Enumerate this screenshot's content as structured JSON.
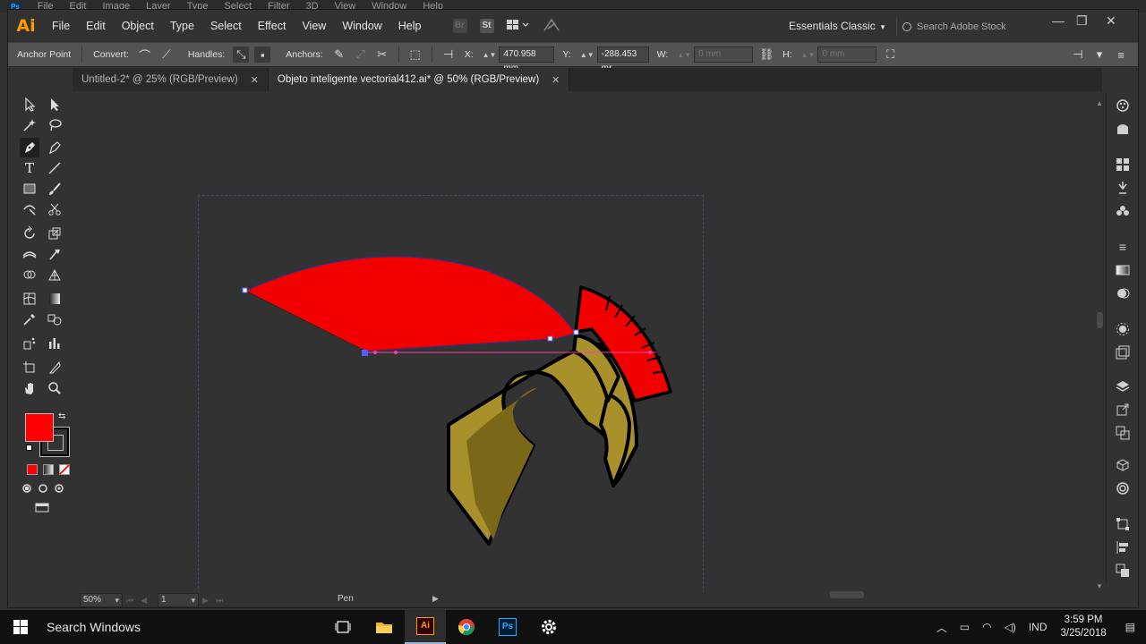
{
  "app": {
    "logo": "Ai",
    "menu": [
      "File",
      "Edit",
      "Object",
      "Type",
      "Select",
      "Effect",
      "View",
      "Window",
      "Help"
    ],
    "menubar_icons": [
      "bridge-icon",
      "stock-icon",
      "arrange-documents-icon",
      "gpu-performance-icon"
    ],
    "menubar_icon_labels": {
      "bridge": "Br",
      "stock": "St"
    },
    "workspace": "Essentials Classic",
    "search_placeholder": "Search Adobe Stock",
    "window_controls": {
      "minimize": "—",
      "restore": "❐",
      "close": "✕"
    }
  },
  "behind_window": {
    "badge": "Ps",
    "menu": [
      "File",
      "Edit",
      "Image",
      "Layer",
      "Type",
      "Select",
      "Filter",
      "3D",
      "View",
      "Window",
      "Help"
    ]
  },
  "controlbar": {
    "anchor_point": "Anchor Point",
    "convert": "Convert:",
    "handles": "Handles:",
    "anchors": "Anchors:",
    "x_label": "X:",
    "x_value": "470.958 mm",
    "y_label": "Y:",
    "y_value": "-288.453 mr",
    "w_label": "W:",
    "w_value": "0 mm",
    "h_label": "H:",
    "h_value": "0 mm"
  },
  "tabs": [
    {
      "label": "Untitled-2* @ 25% (RGB/Preview)",
      "active": false,
      "close": "✕"
    },
    {
      "label": "Objeto inteligente vectorial412.ai* @ 50% (RGB/Preview)",
      "active": true,
      "close": "✕"
    }
  ],
  "tools": [
    "selection",
    "direct-selection",
    "magic-wand",
    "lasso",
    "pen",
    "curvature",
    "type",
    "line-segment",
    "rectangle",
    "paintbrush",
    "shaper",
    "scissors",
    "rotate",
    "scale",
    "width",
    "free-transform",
    "shape-builder",
    "perspective-grid",
    "mesh",
    "gradient",
    "eyedropper",
    "blend",
    "symbol-sprayer",
    "column-graph",
    "artboard",
    "slice",
    "hand",
    "zoom"
  ],
  "tool_labels": {
    "type": "T"
  },
  "colors": {
    "fill": "#ff0000",
    "stroke": "#000000",
    "plume_red": "#f20000",
    "helmet_gold": "#a8902a",
    "helmet_dark": "#7a6818",
    "anchor_blue": "#4a62ff",
    "guide_magenta": "#ff3ea8"
  },
  "statusbar": {
    "zoom": "50%",
    "page": "1",
    "current_tool": "Pen"
  },
  "taskbar": {
    "search": "Search Windows",
    "apps": [
      "task-view-icon",
      "file-explorer-icon",
      "illustrator-icon",
      "chrome-icon",
      "photoshop-icon",
      "settings-icon"
    ],
    "app_labels": {
      "illustrator": "Ai",
      "photoshop": "Ps"
    },
    "language": "IND",
    "time": "3:59 PM",
    "date": "3/25/2018"
  },
  "glyphs": {
    "chev": "⌄",
    "chev_small": "▾",
    "play": "▶",
    "step_first": "⏮",
    "step_prev": "◀",
    "step_next": "▶",
    "step_last": "⏭",
    "stepper": "▲▼",
    "convert_smooth": "⌒",
    "convert_corner": "⟋",
    "handles_show": "⤡",
    "handles_hide": "▪",
    "anchors_remove": "✎",
    "anchors_connect": "⤢",
    "anchors_cut": "✂",
    "select_similar": "⬚",
    "align": "⊣",
    "link": "⛓",
    "transform": "⛶",
    "menu": "≡"
  }
}
